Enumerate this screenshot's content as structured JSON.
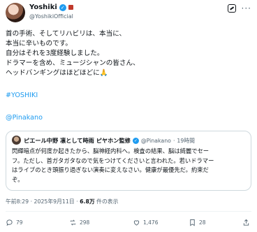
{
  "author": {
    "name": "Yoshiki",
    "handle": "@YoshikiOfficial"
  },
  "post": {
    "lines": [
      "首の手術、そしてリハビリは、本当に、",
      "本当に辛いものです。",
      "自分はそれを3度経験しました。",
      "ドラマーを含め、ミュージシャンの皆さん、",
      "ヘッドバンギングはほどほどに🙏"
    ],
    "hashtag": "#YOSHIKI",
    "mention": "@Pinakano"
  },
  "quote": {
    "name": "ピエール中野 凛として時雨 ピヤホン監修",
    "handle": "@Pinakano",
    "dot": "·",
    "time": "19時間",
    "lines": [
      "閃輝暗点が何度か起きたから、脳神経内科へ。検査の結果、脳は綺麗でセー",
      "フ。ただし、首ガタガタなので気をつけてくださいと言われた。若いドラマー",
      "はライブのとき頭振り過ぎない演奏に変えなさい。健康が最優先だ。約束だ",
      "ぞ。"
    ]
  },
  "meta": {
    "time": "午前8:29 · 2025年9月11日 · ",
    "views": "6.8万",
    "views_label": " 件の表示"
  },
  "actions": {
    "replies": "79",
    "reposts": "298",
    "likes": "1,476",
    "bookmarks": "28"
  },
  "colors": {
    "accent": "#1d9bf0",
    "muted": "#536471"
  }
}
